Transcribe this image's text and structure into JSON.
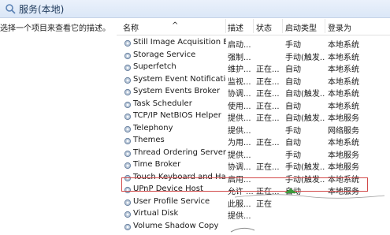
{
  "window": {
    "title": "服务(本地)",
    "icon": "services-icon"
  },
  "hint": "选择一个项目来查看它的描述。",
  "columns": {
    "name": "名称",
    "description": "描述",
    "status": "状态",
    "startup": "启动类型",
    "logon": "登录为"
  },
  "rows": [
    {
      "name": "Still Image Acquisition Ev...",
      "desc": "启动...",
      "status": "",
      "start": "手动",
      "logon": "本地系统"
    },
    {
      "name": "Storage Service",
      "desc": "强制...",
      "status": "",
      "start": "手动(触发...",
      "logon": "本地系统"
    },
    {
      "name": "Superfetch",
      "desc": "维护...",
      "status": "正在...",
      "start": "自动",
      "logon": "本地系统"
    },
    {
      "name": "System Event Notification...",
      "desc": "监视...",
      "status": "正在...",
      "start": "自动",
      "logon": "本地系统"
    },
    {
      "name": "System Events Broker",
      "desc": "协调...",
      "status": "正在...",
      "start": "自动(触发...",
      "logon": "本地系统"
    },
    {
      "name": "Task Scheduler",
      "desc": "使用...",
      "status": "正在...",
      "start": "自动",
      "logon": "本地系统"
    },
    {
      "name": "TCP/IP NetBIOS Helper",
      "desc": "提供...",
      "status": "正在...",
      "start": "自动(触发...",
      "logon": "本地服务"
    },
    {
      "name": "Telephony",
      "desc": "提供...",
      "status": "",
      "start": "手动",
      "logon": "网络服务"
    },
    {
      "name": "Themes",
      "desc": "为用...",
      "status": "正在...",
      "start": "自动",
      "logon": "本地系统"
    },
    {
      "name": "Thread Ordering Server",
      "desc": "提供...",
      "status": "",
      "start": "手动",
      "logon": "本地服务"
    },
    {
      "name": "Time Broker",
      "desc": "协调...",
      "status": "正在...",
      "start": "手动(触发...",
      "logon": "本地服务"
    },
    {
      "name": "Touch Keyboard and Ha...",
      "desc": "启用...",
      "status": "",
      "start": "手动(触发...",
      "logon": "本地系统"
    },
    {
      "name": "UPnP Device Host",
      "desc": "允许 ...",
      "status": "正在...",
      "start": "自动",
      "logon": "本地服务"
    },
    {
      "name": "User Profile Service",
      "desc": "此服...",
      "status": "正在",
      "start": "",
      "logon": ""
    },
    {
      "name": "Virtual Disk",
      "desc": "提供...",
      "status": "",
      "start": "",
      "logon": ""
    },
    {
      "name": "Volume Shadow Copy",
      "desc": "",
      "status": "",
      "start": "",
      "logon": ""
    }
  ],
  "accent": {
    "highlight_border": "#d24a4a",
    "arrow": "#3c9a3c"
  }
}
